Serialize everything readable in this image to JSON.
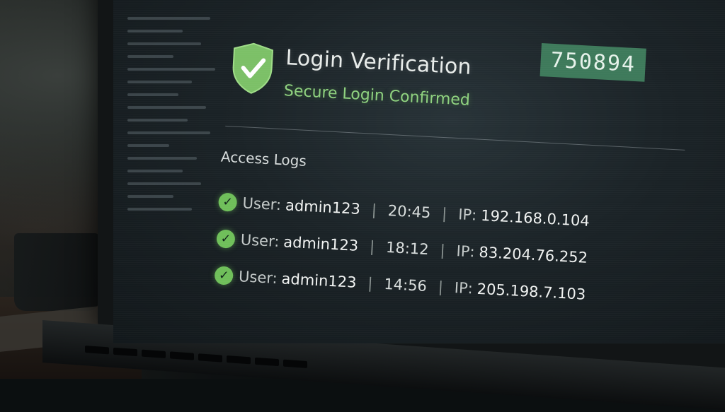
{
  "header": {
    "title": "Login Verification",
    "subtitle": "Secure Login Confirmed",
    "code": "750894"
  },
  "access_logs": {
    "heading": "Access Logs",
    "user_prefix": "User:",
    "ip_prefix": "IP:",
    "separator": "|",
    "entries": [
      {
        "user": "admin123",
        "time": "20:45",
        "ip": "192.168.0.104"
      },
      {
        "user": "admin123",
        "time": "18:12",
        "ip": "83.204.76.252"
      },
      {
        "user": "admin123",
        "time": "14:56",
        "ip": "205.198.7.103"
      }
    ]
  },
  "icons": {
    "shield": "shield-check-icon",
    "row_check": "check-circle-icon"
  },
  "colors": {
    "accent_green": "#8fd27f",
    "shield_green": "#6fbf5a",
    "code_badge_bg": "#3e7a5b",
    "screen_bg": "#1b2327"
  }
}
